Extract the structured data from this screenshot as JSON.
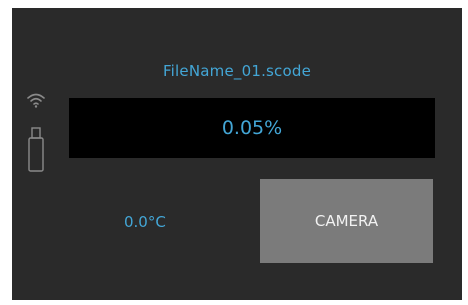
{
  "file": {
    "name": "FileName_01.scode"
  },
  "status": {
    "progress": "0.05%",
    "temperature": "0.0°C"
  },
  "buttons": {
    "camera_label": "CAMERA"
  },
  "icons": {
    "wifi": "wifi-icon",
    "usb": "usb-icon"
  },
  "colors": {
    "accent": "#43a6d6",
    "screen_bg": "#2a2a2a",
    "panel_bg": "#000000",
    "button_bg": "#7b7b7b"
  }
}
